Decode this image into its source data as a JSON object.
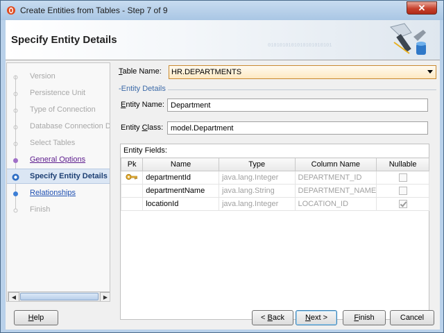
{
  "window": {
    "title": "Create Entities from Tables - Step 7 of 9",
    "close_label": "✕"
  },
  "banner": {
    "title": "Specify Entity Details",
    "decoration_text": "0101010101010101010101"
  },
  "nav": {
    "items": [
      {
        "label": "Version",
        "state": "done"
      },
      {
        "label": "Persistence Unit",
        "state": "done"
      },
      {
        "label": "Type of Connection",
        "state": "done"
      },
      {
        "label": "Database Connection De",
        "state": "done"
      },
      {
        "label": "Select Tables",
        "state": "done"
      },
      {
        "label": "General Options",
        "state": "link"
      },
      {
        "label": "Specify Entity Details",
        "state": "current"
      },
      {
        "label": "Relationships",
        "state": "next"
      },
      {
        "label": "Finish",
        "state": "todo"
      }
    ]
  },
  "form": {
    "table_name_label": "Table Name:",
    "table_name_label_u": "T",
    "table_name_label_rest": "able Name:",
    "table_name_value": "HR.DEPARTMENTS",
    "section_title": "Entity Details",
    "entity_name_label_u": "E",
    "entity_name_label_rest": "ntity Name:",
    "entity_name_value": "Department",
    "entity_class_label_pre": "Entity ",
    "entity_class_label_u": "C",
    "entity_class_label_rest": "lass:",
    "entity_class_value": "model.Department",
    "fields_label": "Entity Fields:"
  },
  "fields_table": {
    "headers": [
      "Pk",
      "Name",
      "Type",
      "Column Name",
      "Nullable"
    ],
    "rows": [
      {
        "pk": true,
        "name": "departmentId",
        "type": "java.lang.Integer",
        "column": "DEPARTMENT_ID",
        "nullable": false
      },
      {
        "pk": false,
        "name": "departmentName",
        "type": "java.lang.String",
        "column": "DEPARTMENT_NAME",
        "nullable": false
      },
      {
        "pk": false,
        "name": "locationId",
        "type": "java.lang.Integer",
        "column": "LOCATION_ID",
        "nullable": true
      }
    ]
  },
  "buttons": {
    "help_u": "H",
    "help_rest": "elp",
    "back_pre": "< ",
    "back_u": "B",
    "back_rest": "ack",
    "next_u": "N",
    "next_rest": "ext >",
    "finish_u": "F",
    "finish_rest": "inish",
    "cancel": "Cancel"
  },
  "icons": {
    "app": "oracle-jdeveloper-icon",
    "pk": "key-icon",
    "banner": "wizard-tools-icon"
  }
}
